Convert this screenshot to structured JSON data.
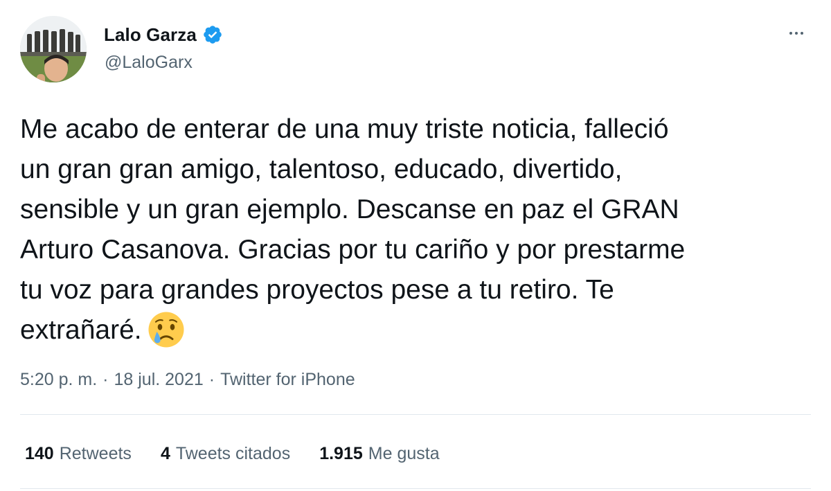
{
  "author": {
    "display_name": "Lalo Garza",
    "handle": "@LaloGarx",
    "verified": true,
    "avatar_icon": "profile-photo",
    "verified_icon": "verified-badge-icon"
  },
  "menu": {
    "icon": "more-options-icon"
  },
  "tweet": {
    "lines": [
      "Me acabo de enterar de una muy triste noticia, falleció",
      "un gran gran amigo, talentoso, educado, divertido,",
      "sensible y un gran ejemplo. Descanse en paz el GRAN",
      "Arturo Casanova. Gracias por tu cariño y por prestarme",
      "tu voz para grandes proyectos pese a tu retiro. Te",
      "extrañaré."
    ],
    "emoji": "crying-face-emoji"
  },
  "meta": {
    "time": "5:20 p. m.",
    "separator": "·",
    "date": "18 jul. 2021",
    "source": "Twitter for iPhone"
  },
  "stats": {
    "retweets_count": "140",
    "retweets_label": "Retweets",
    "quotes_count": "4",
    "quotes_label": "Tweets citados",
    "likes_count": "1.915",
    "likes_label": "Me gusta"
  },
  "colors": {
    "text": "#0f1419",
    "secondary": "#536471",
    "verified": "#1d9bf0",
    "divider": "#e1e8ed"
  }
}
